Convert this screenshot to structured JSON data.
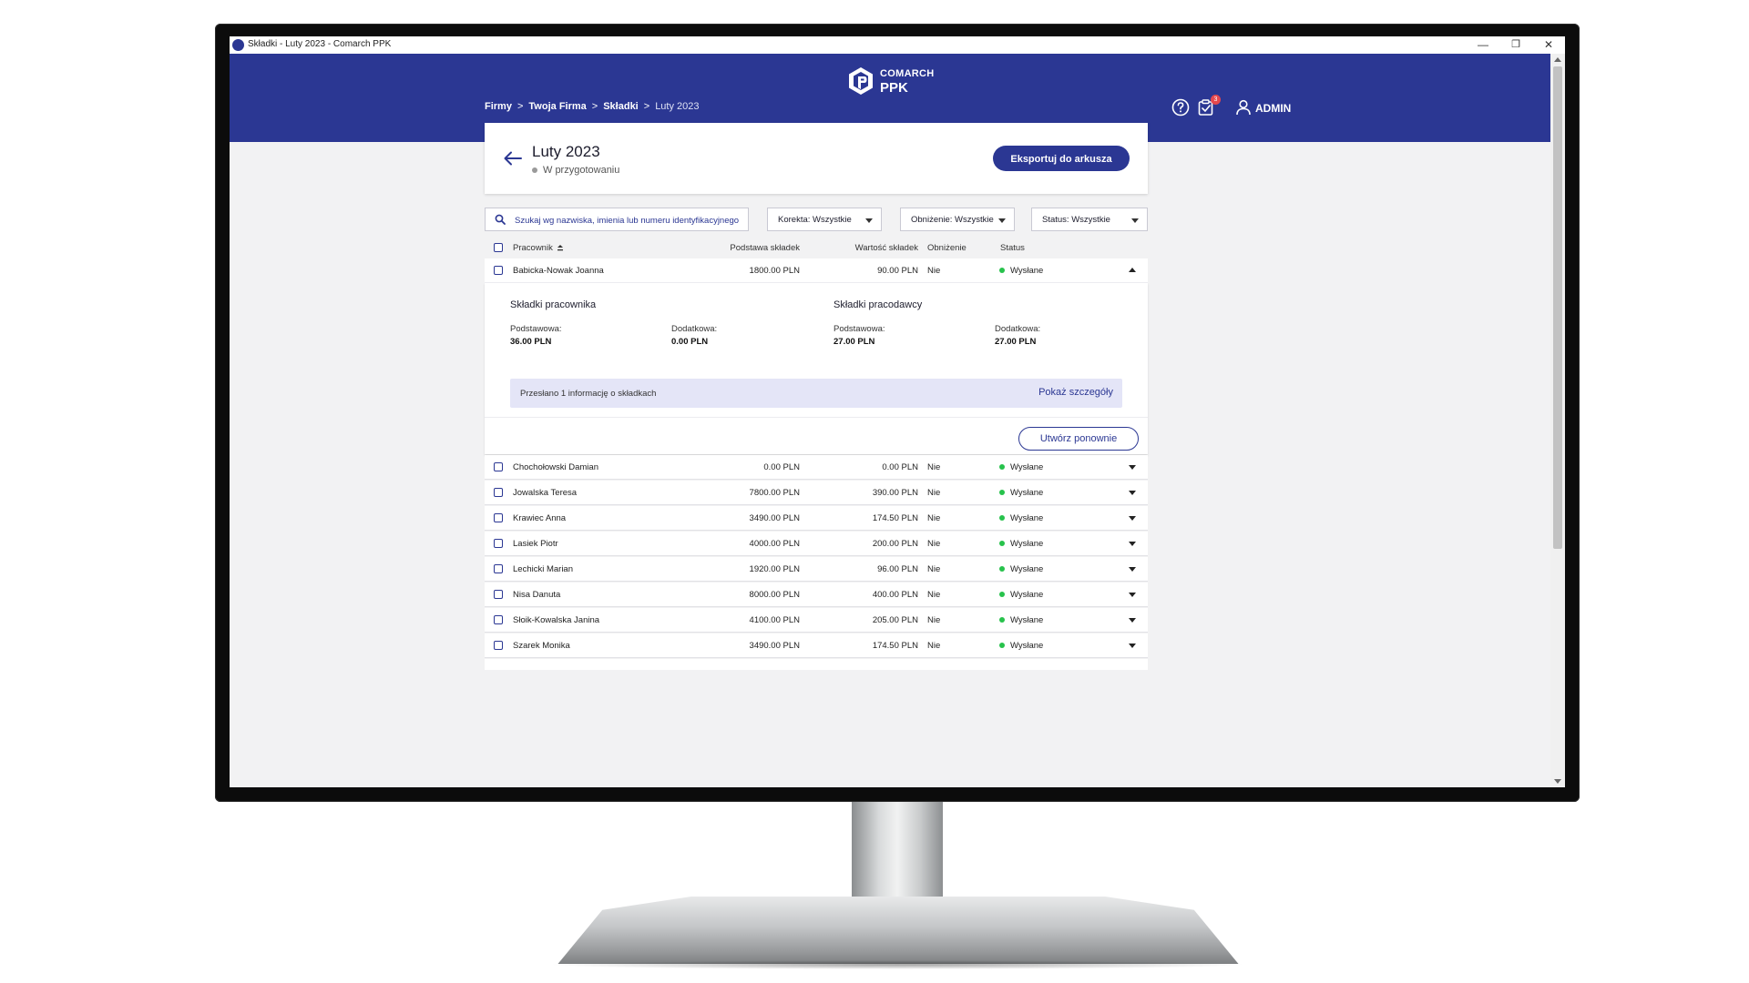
{
  "window": {
    "title": "Składki - Luty 2023 - Comarch PPK",
    "minimize": "—",
    "maximize": "❐",
    "close": "✕"
  },
  "header": {
    "brand_top": "COMARCH",
    "brand_bottom": "PPK",
    "breadcrumb": [
      "Firmy",
      "Twoja Firma",
      "Składki",
      "Luty 2023"
    ],
    "breadcrumb_sep": ">",
    "notification_count": "3",
    "user_label": "ADMIN",
    "brand_color": "#2b3793"
  },
  "page": {
    "title": "Luty 2023",
    "status": "W przygotowaniu",
    "export_label": "Eksportuj do arkusza"
  },
  "filters": {
    "search_placeholder": "Szukaj wg nazwiska, imienia lub numeru identyfikacyjnego",
    "korekta": "Korekta: Wszystkie",
    "obnizenie": "Obniżenie: Wszystkie",
    "status": "Status: Wszystkie"
  },
  "table": {
    "headers": {
      "employee": "Pracownik",
      "base": "Podstawa składek",
      "value": "Wartość składek",
      "reduction": "Obniżenie",
      "status": "Status"
    },
    "rows": [
      {
        "name": "Babicka-Nowak Joanna",
        "base": "1800.00 PLN",
        "value": "90.00 PLN",
        "reduction": "Nie",
        "status": "Wysłane"
      },
      {
        "name": "Chochołowski Damian",
        "base": "0.00 PLN",
        "value": "0.00 PLN",
        "reduction": "Nie",
        "status": "Wysłane"
      },
      {
        "name": "Jowalska Teresa",
        "base": "7800.00 PLN",
        "value": "390.00 PLN",
        "reduction": "Nie",
        "status": "Wysłane"
      },
      {
        "name": "Krawiec Anna",
        "base": "3490.00 PLN",
        "value": "174.50 PLN",
        "reduction": "Nie",
        "status": "Wysłane"
      },
      {
        "name": "Lasiek Piotr",
        "base": "4000.00 PLN",
        "value": "200.00 PLN",
        "reduction": "Nie",
        "status": "Wysłane"
      },
      {
        "name": "Lechicki Marian",
        "base": "1920.00 PLN",
        "value": "96.00 PLN",
        "reduction": "Nie",
        "status": "Wysłane"
      },
      {
        "name": "Nisa Danuta",
        "base": "8000.00 PLN",
        "value": "400.00 PLN",
        "reduction": "Nie",
        "status": "Wysłane"
      },
      {
        "name": "Słoik-Kowalska Janina",
        "base": "4100.00 PLN",
        "value": "205.00 PLN",
        "reduction": "Nie",
        "status": "Wysłane"
      },
      {
        "name": "Szarek Monika",
        "base": "3490.00 PLN",
        "value": "174.50 PLN",
        "reduction": "Nie",
        "status": "Wysłane"
      }
    ]
  },
  "detail": {
    "employee_title": "Składki pracownika",
    "employer_title": "Składki pracodawcy",
    "basic_label": "Podstawowa:",
    "extra_label": "Dodatkowa:",
    "employee_basic": "36.00 PLN",
    "employee_extra": "0.00 PLN",
    "employer_basic": "27.00 PLN",
    "employer_extra": "27.00 PLN",
    "info_text": "Przesłano 1 informację o składkach",
    "info_link": "Pokaż szczegóły",
    "recreate_label": "Utwórz ponownie"
  }
}
